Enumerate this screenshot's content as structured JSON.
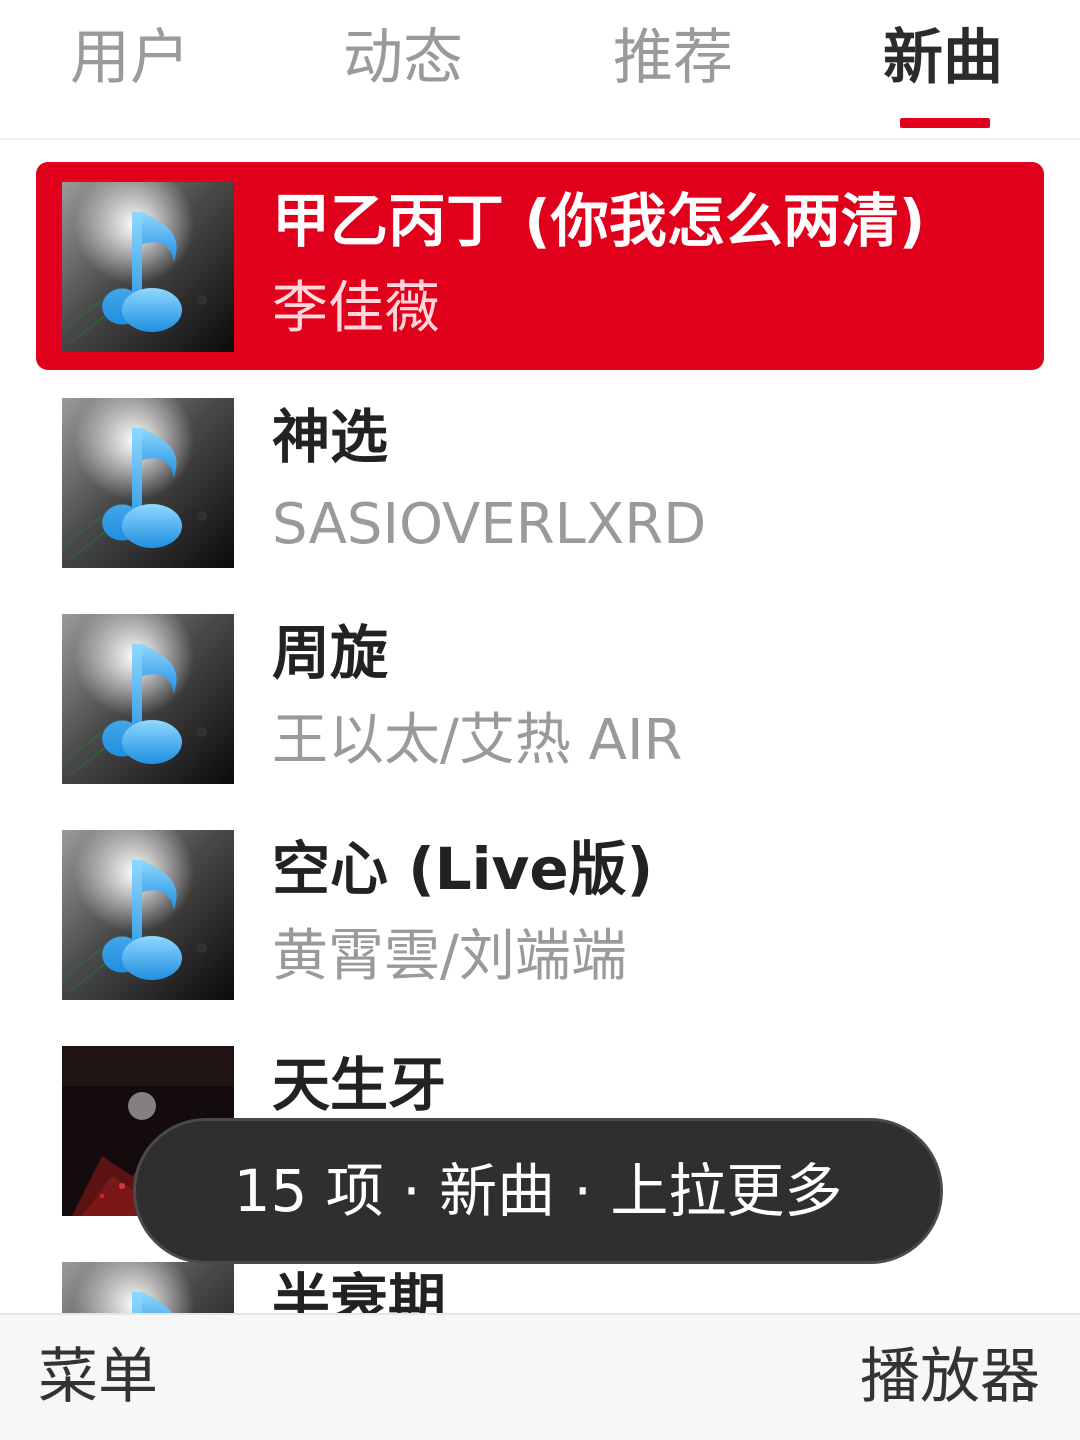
{
  "tabs": {
    "items": [
      {
        "label": "用户"
      },
      {
        "label": "动态"
      },
      {
        "label": "推荐"
      },
      {
        "label": "新曲"
      }
    ],
    "active_index": 3,
    "accent_color": "#e0001b"
  },
  "songs": [
    {
      "title": "甲乙丙丁 (你我怎么两清)",
      "artist": "李佳薇",
      "selected": true,
      "cover": "music-note-icon"
    },
    {
      "title": "神选",
      "artist": "SASIOVERLXRD",
      "cover": "music-note-icon"
    },
    {
      "title": "周旋",
      "artist": "王以太/艾热 AIR",
      "cover": "music-note-icon"
    },
    {
      "title": "空心 (Live版)",
      "artist": "黄霄雲/刘端端",
      "cover": "music-note-icon"
    },
    {
      "title": "天生牙",
      "artist": "",
      "cover": "album-art"
    },
    {
      "title": "半衰期",
      "artist": "",
      "cover": "music-note-icon"
    }
  ],
  "toast": {
    "text": "15 项 · 新曲 · 上拉更多"
  },
  "softkeys": {
    "left": "菜单",
    "right": "播放器"
  }
}
